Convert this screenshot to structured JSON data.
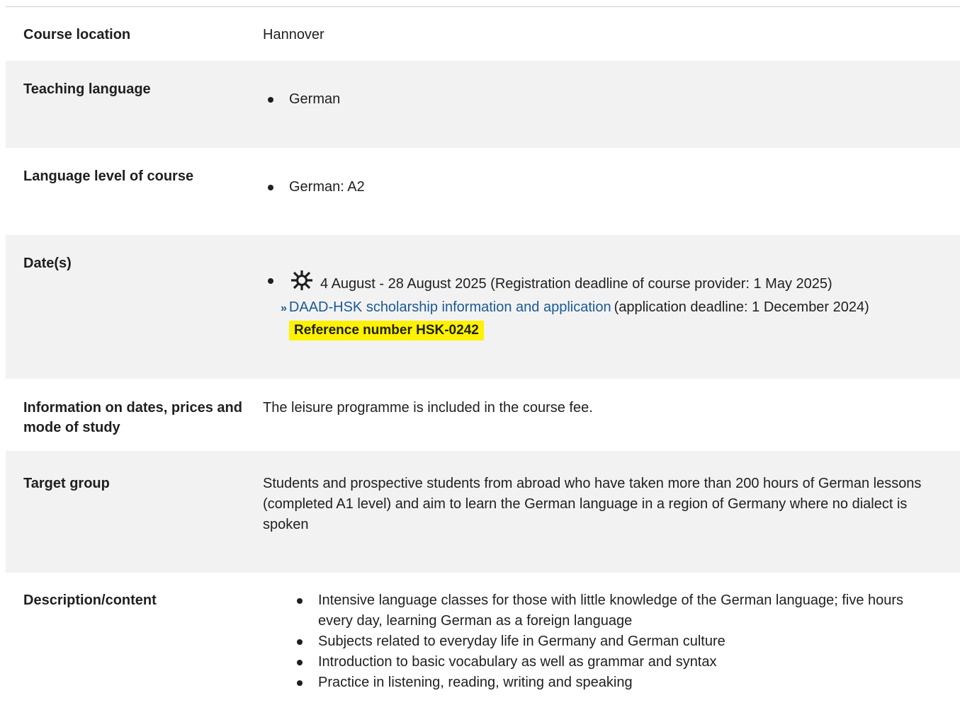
{
  "rows": {
    "location": {
      "label": "Course location",
      "value": "Hannover"
    },
    "teaching_language": {
      "label": "Teaching language",
      "items": [
        "German"
      ]
    },
    "language_level": {
      "label": "Language level of course",
      "items": [
        "German: A2"
      ]
    },
    "dates": {
      "label": "Date(s)",
      "icon": "sun-icon",
      "date_text": "4 August - 28 August 2025 (Registration deadline of course provider: 1 May 2025)",
      "link_arrow": "»",
      "link_text": "DAAD-HSK scholarship information and application",
      "link_suffix": "(application deadline: 1 December 2024)",
      "reference": "Reference number HSK-0242",
      "reference_color": "#fff200"
    },
    "info": {
      "label": "Information on dates, prices and mode of study",
      "value": "The leisure programme is included in the course fee."
    },
    "target_group": {
      "label": "Target group",
      "value": "Students and prospective students from abroad who have taken more than 200 hours of German lessons (completed A1 level) and aim to learn the German language in a region of Germany where no dialect is spoken"
    },
    "description": {
      "label": "Description/content",
      "items": [
        "Intensive language classes for those with little knowledge of the German language; five hours every day, learning German as a foreign language",
        "Subjects related to everyday life in Germany and German culture",
        "Introduction to basic vocabulary as well as grammar and syntax",
        "Practice in listening, reading, writing and speaking"
      ]
    }
  },
  "colors": {
    "shaded_row": "#f2f2f2",
    "link": "#1a5a96",
    "highlight": "#fff200"
  }
}
